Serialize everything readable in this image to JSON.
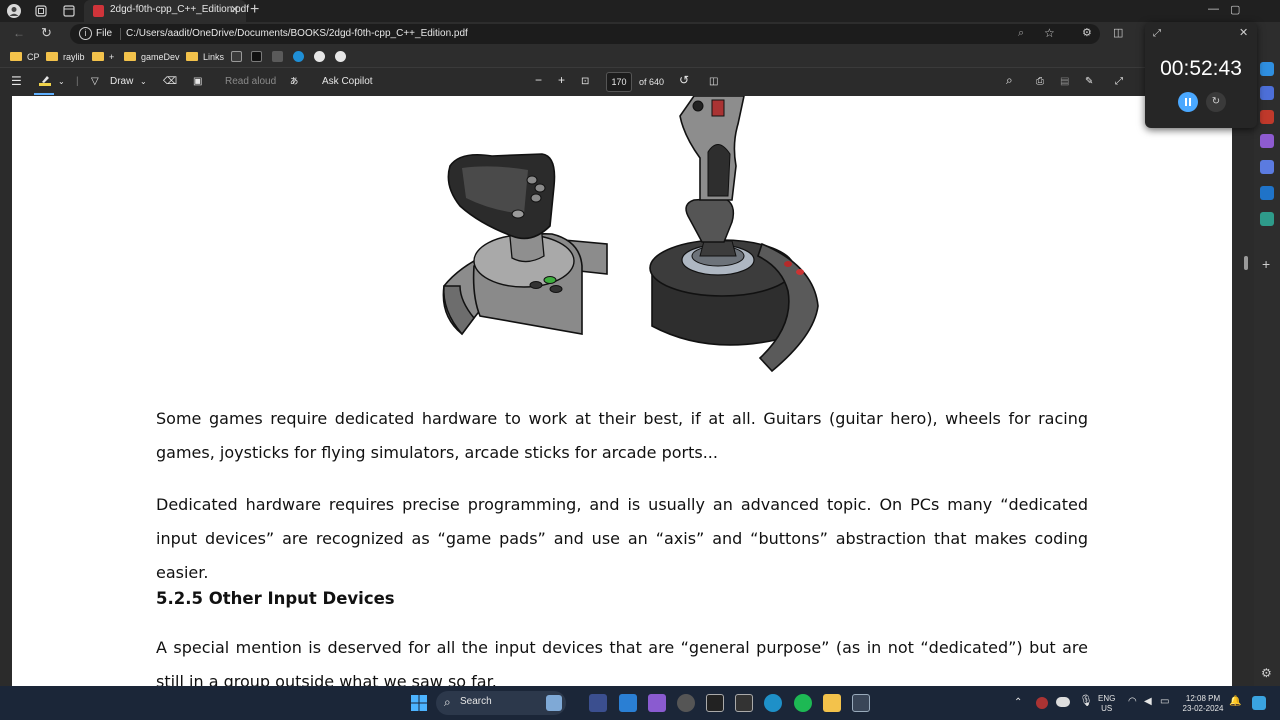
{
  "tab": {
    "title": "2dgd-f0th-cpp_C++_Edition.pdf"
  },
  "address": {
    "scheme_label": "File",
    "url": "C:/Users/aadit/OneDrive/Documents/BOOKS/2dgd-f0th-cpp_C++_Edition.pdf"
  },
  "bookmarks": [
    {
      "label": "CP",
      "icon": "folder-icon"
    },
    {
      "label": "raylib",
      "icon": "folder-icon"
    },
    {
      "label": "+",
      "icon": "folder-icon"
    },
    {
      "label": "gameDev",
      "icon": "folder-icon"
    },
    {
      "label": "Links",
      "icon": "folder-icon"
    }
  ],
  "pdf_toolbar": {
    "draw_label": "Draw",
    "read_aloud_label": "Read aloud",
    "ask_copilot_label": "Ask Copilot",
    "current_page": "170",
    "total_pages_label": "of 640"
  },
  "document": {
    "paragraph1": "Some games require dedicated hardware to work at their best, if at all.  Guitars (guitar hero), wheels for racing games, joysticks for flying simulators, arcade sticks for arcade ports...",
    "paragraph2": "Dedicated hardware requires precise programming, and is usually an advanced topic.  On PCs many “dedicated input devices” are recognized as “game pads” and use an “axis” and “buttons” abstraction that makes coding easier.",
    "heading": "5.2.5   Other Input Devices",
    "paragraph3": "A special mention is deserved for all the input devices that are “general purpose” (as in not “dedicated”) but are still in a group outside what we saw so far."
  },
  "timer": {
    "value": "00:52:43"
  },
  "taskbar": {
    "search_label": "Search",
    "language_top": "ENG",
    "language_bottom": "US",
    "time": "12:08 PM",
    "date": "23-02-2024"
  },
  "colors": {
    "accent": "#4aa8ff",
    "pdf_icon": "#d0343a",
    "folder": "#f3c24b"
  }
}
